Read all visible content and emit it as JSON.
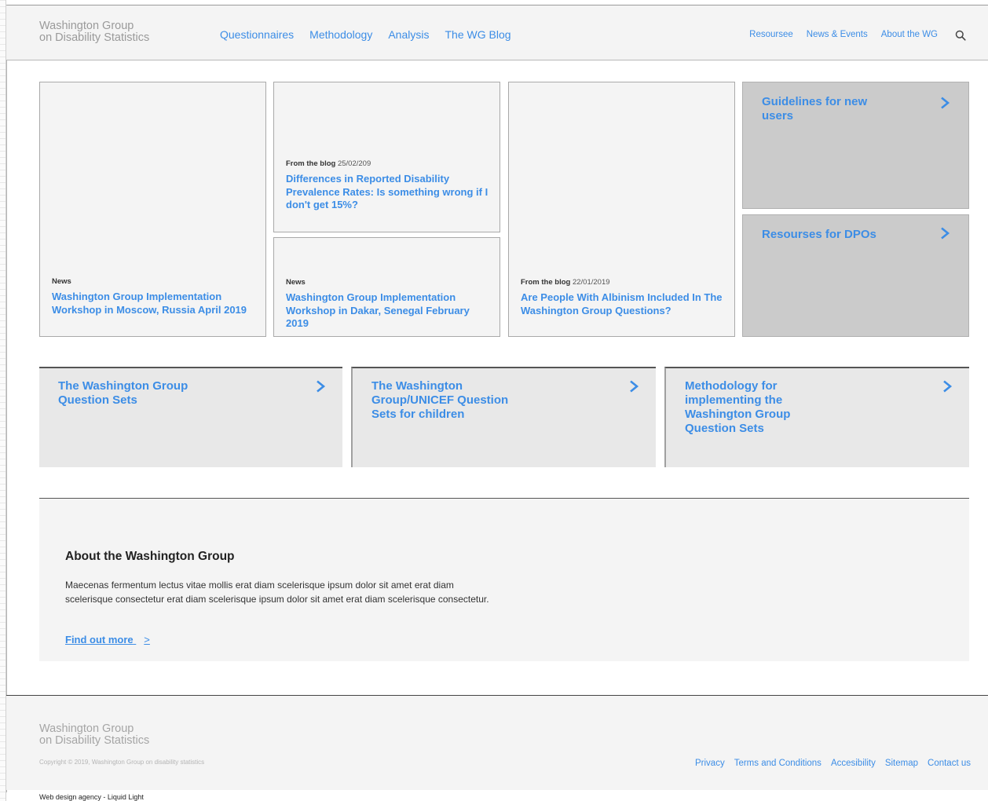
{
  "header": {
    "logo_line1": "Washington Group",
    "logo_line2": "on Disability Statistics",
    "main_nav": [
      "Questionnaires",
      "Methodology",
      "Analysis",
      "The WG Blog"
    ],
    "secondary_nav": [
      "Resoursee",
      "News & Events",
      "About the WG"
    ]
  },
  "cards": {
    "news1": {
      "category": "News",
      "date": "",
      "title": "Washington Group Implementation Workshop in Moscow, Russia April 2019"
    },
    "blog1": {
      "category": "From the blog",
      "date": "25/02/209",
      "title": "Differences in Reported Disability Prevalence Rates: Is something wrong if I don't get 15%?"
    },
    "news2": {
      "category": "News",
      "date": "",
      "title": "Washington Group Implementation Workshop in Dakar, Senegal February 2019"
    },
    "blog2": {
      "category": "From the blog",
      "date": "22/01/2019",
      "title": "Are People With Albinism Included In The Washington Group Questions?"
    },
    "guidelines": {
      "title": "Guidelines for new users"
    },
    "resources": {
      "title": "Resourses for DPOs"
    }
  },
  "question_sets": [
    {
      "title": "The Washington Group Question Sets"
    },
    {
      "title": "The Washington Group/UNICEF Question Sets for children"
    },
    {
      "title": "Methodology for implementing the Washington Group Question Sets"
    }
  ],
  "about": {
    "heading": "About the Washington Group",
    "body": "Maecenas fermentum lectus vitae mollis erat diam scelerisque ipsum dolor sit amet erat diam scelerisque consectetur erat diam scelerisque ipsum dolor sit amet erat diam scelerisque consectetur.",
    "link": "Find out more"
  },
  "footer": {
    "logo_line1": "Washington Group",
    "logo_line2": "on Disability Statistics",
    "copyright": "Copyright © 2019, Washington Group on disability statistics",
    "links": [
      "Privacy",
      "Terms and Conditions",
      "Accesibility",
      "Sitemap",
      "Contact us"
    ],
    "agency": "Web design agency - Liquid Light"
  },
  "colors": {
    "link": "#3c8de6",
    "tile_grey": "#cbcbcb",
    "panel": "#f4f4f4"
  },
  "icons": {
    "search": "search-icon",
    "chevron": "chevron-right-icon"
  }
}
